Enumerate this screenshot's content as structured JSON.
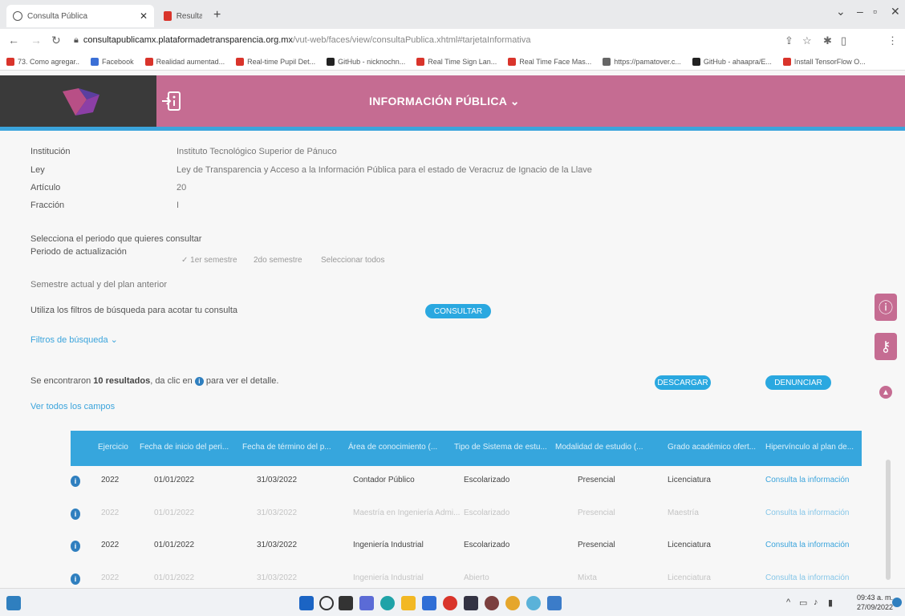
{
  "browser": {
    "tabs": [
      {
        "label": "Consulta Pública",
        "icon": "globe-icon",
        "active": true
      },
      {
        "label": "Resultados de búsqueda - hecto",
        "icon": "gmail-icon",
        "active": false
      }
    ],
    "url_host": "consultapublicamx.plataformadetransparencia.org.mx",
    "url_path": "/vut-web/faces/view/consultaPublica.xhtml#tarjetaInformativa",
    "bookmarks": [
      {
        "label": "73. Como agregar..",
        "color": "#d9342b"
      },
      {
        "label": "Facebook",
        "color": "#3b6fd6"
      },
      {
        "label": "Realidad aumentad...",
        "color": "#d9342b"
      },
      {
        "label": "Real-time Pupil Det...",
        "color": "#d9342b"
      },
      {
        "label": "GitHub - nicknochn...",
        "color": "#222222"
      },
      {
        "label": "Real Time Sign Lan...",
        "color": "#d9342b"
      },
      {
        "label": "Real Time Face Mas...",
        "color": "#d9342b"
      },
      {
        "label": "https://pamatover.c...",
        "color": "#666666"
      },
      {
        "label": "GitHub - ahaapra/E...",
        "color": "#222222"
      },
      {
        "label": "Install TensorFlow O...",
        "color": "#d9342b"
      }
    ]
  },
  "header": {
    "title": "INFORMACIÓN PÚBLICA ⌄",
    "accent": "#c56c92",
    "stripe": "#3ba4dc"
  },
  "details": [
    {
      "label": "Institución",
      "value": "Instituto Tecnológico Superior de Pánuco"
    },
    {
      "label": "Ley",
      "value": "Ley de Transparencia y Acceso a la Información Pública para el estado de Veracruz de Ignacio de la Llave"
    },
    {
      "label": "Artículo",
      "value": "20"
    },
    {
      "label": "Fracción",
      "value": "I"
    }
  ],
  "period": {
    "prompt": "Selecciona el periodo que quieres consultar",
    "label": "Periodo de actualización",
    "options": [
      "1er semestre",
      "2do semestre",
      "Seleccionar todos"
    ],
    "note": "Semestre actual y del plan anterior"
  },
  "search": {
    "hint": "Utiliza los filtros de búsqueda para acotar tu consulta",
    "button": "CONSULTAR",
    "filters": "Filtros de búsqueda ⌄"
  },
  "results": {
    "prefix": "Se encontraron ",
    "count": "10 resultados",
    "suffix_1": ", da clic en ",
    "suffix_2": " para ver el detalle.",
    "download": "DESCARGAR",
    "report": "DENUNCIAR",
    "all_fields": "Ver todos los campos"
  },
  "table": {
    "columns": [
      "Ejercicio",
      "Fecha de inicio del peri...",
      "Fecha de término del p...",
      "Área de conocimiento (...",
      "Tipo de Sistema de estu...",
      "Modalidad de estudio (...",
      "Grado académico ofert...",
      "Hipervínculo al plan de..."
    ],
    "rows": [
      [
        "2022",
        "01/01/2022",
        "31/03/2022",
        "Contador Público",
        "Escolarizado",
        "Presencial",
        "Licenciatura",
        "Consulta la información"
      ],
      [
        "2022",
        "01/01/2022",
        "31/03/2022",
        "Maestría en Ingeniería Admi...",
        "Escolarizado",
        "Presencial",
        "Maestría",
        "Consulta la información"
      ],
      [
        "2022",
        "01/01/2022",
        "31/03/2022",
        "Ingeniería Industrial",
        "Escolarizado",
        "Presencial",
        "Licenciatura",
        "Consulta la información"
      ],
      [
        "2022",
        "01/01/2022",
        "31/03/2022",
        "Ingeniería Industrial",
        "Abierto",
        "Mixta",
        "Licenciatura",
        "Consulta la información"
      ]
    ]
  },
  "taskbar": {
    "time": "09:43 a. m.",
    "date": "27/09/2022"
  }
}
